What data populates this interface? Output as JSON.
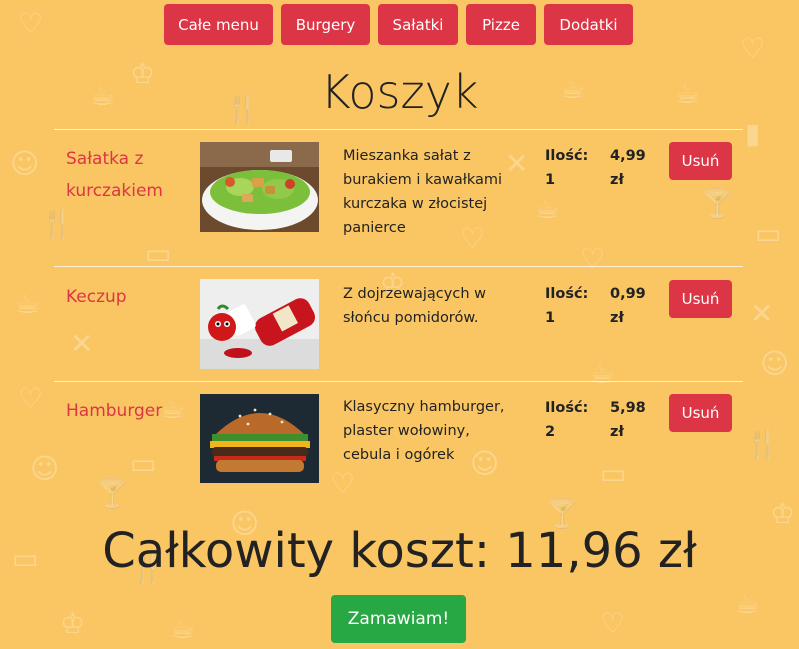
{
  "nav": {
    "items": [
      {
        "label": "Całe menu"
      },
      {
        "label": "Burgery"
      },
      {
        "label": "Sałatki"
      },
      {
        "label": "Pizze"
      },
      {
        "label": "Dodatki"
      }
    ]
  },
  "cart": {
    "title": "Koszyk",
    "items": [
      {
        "name": "Sałatka z kurczakiem",
        "image": "salad-photo",
        "description": "Mieszanka sałat z burakiem i kawałkami kurczaka w złocistej panierce",
        "qty_label": "Ilość:",
        "qty": "1",
        "price": "4,99",
        "currency": "zł",
        "remove_label": "Usuń"
      },
      {
        "name": "Keczup",
        "image": "ketchup-photo",
        "description": "Z dojrzewających w słońcu pomidorów.",
        "qty_label": "Ilość:",
        "qty": "1",
        "price": "0,99",
        "currency": "zł",
        "remove_label": "Usuń"
      },
      {
        "name": "Hamburger",
        "image": "hamburger-photo",
        "description": "Klasyczny hamburger, plaster wołowiny, cebula i ogórek",
        "qty_label": "Ilość:",
        "qty": "2",
        "price": "5,98",
        "currency": "zł",
        "remove_label": "Usuń"
      }
    ],
    "total_label": "Całkowity koszt: 11,96 zł",
    "order_label": "Zamawiam!"
  },
  "colors": {
    "background": "#fac664",
    "accent_red": "#dc3545",
    "order_green": "#28a745"
  }
}
